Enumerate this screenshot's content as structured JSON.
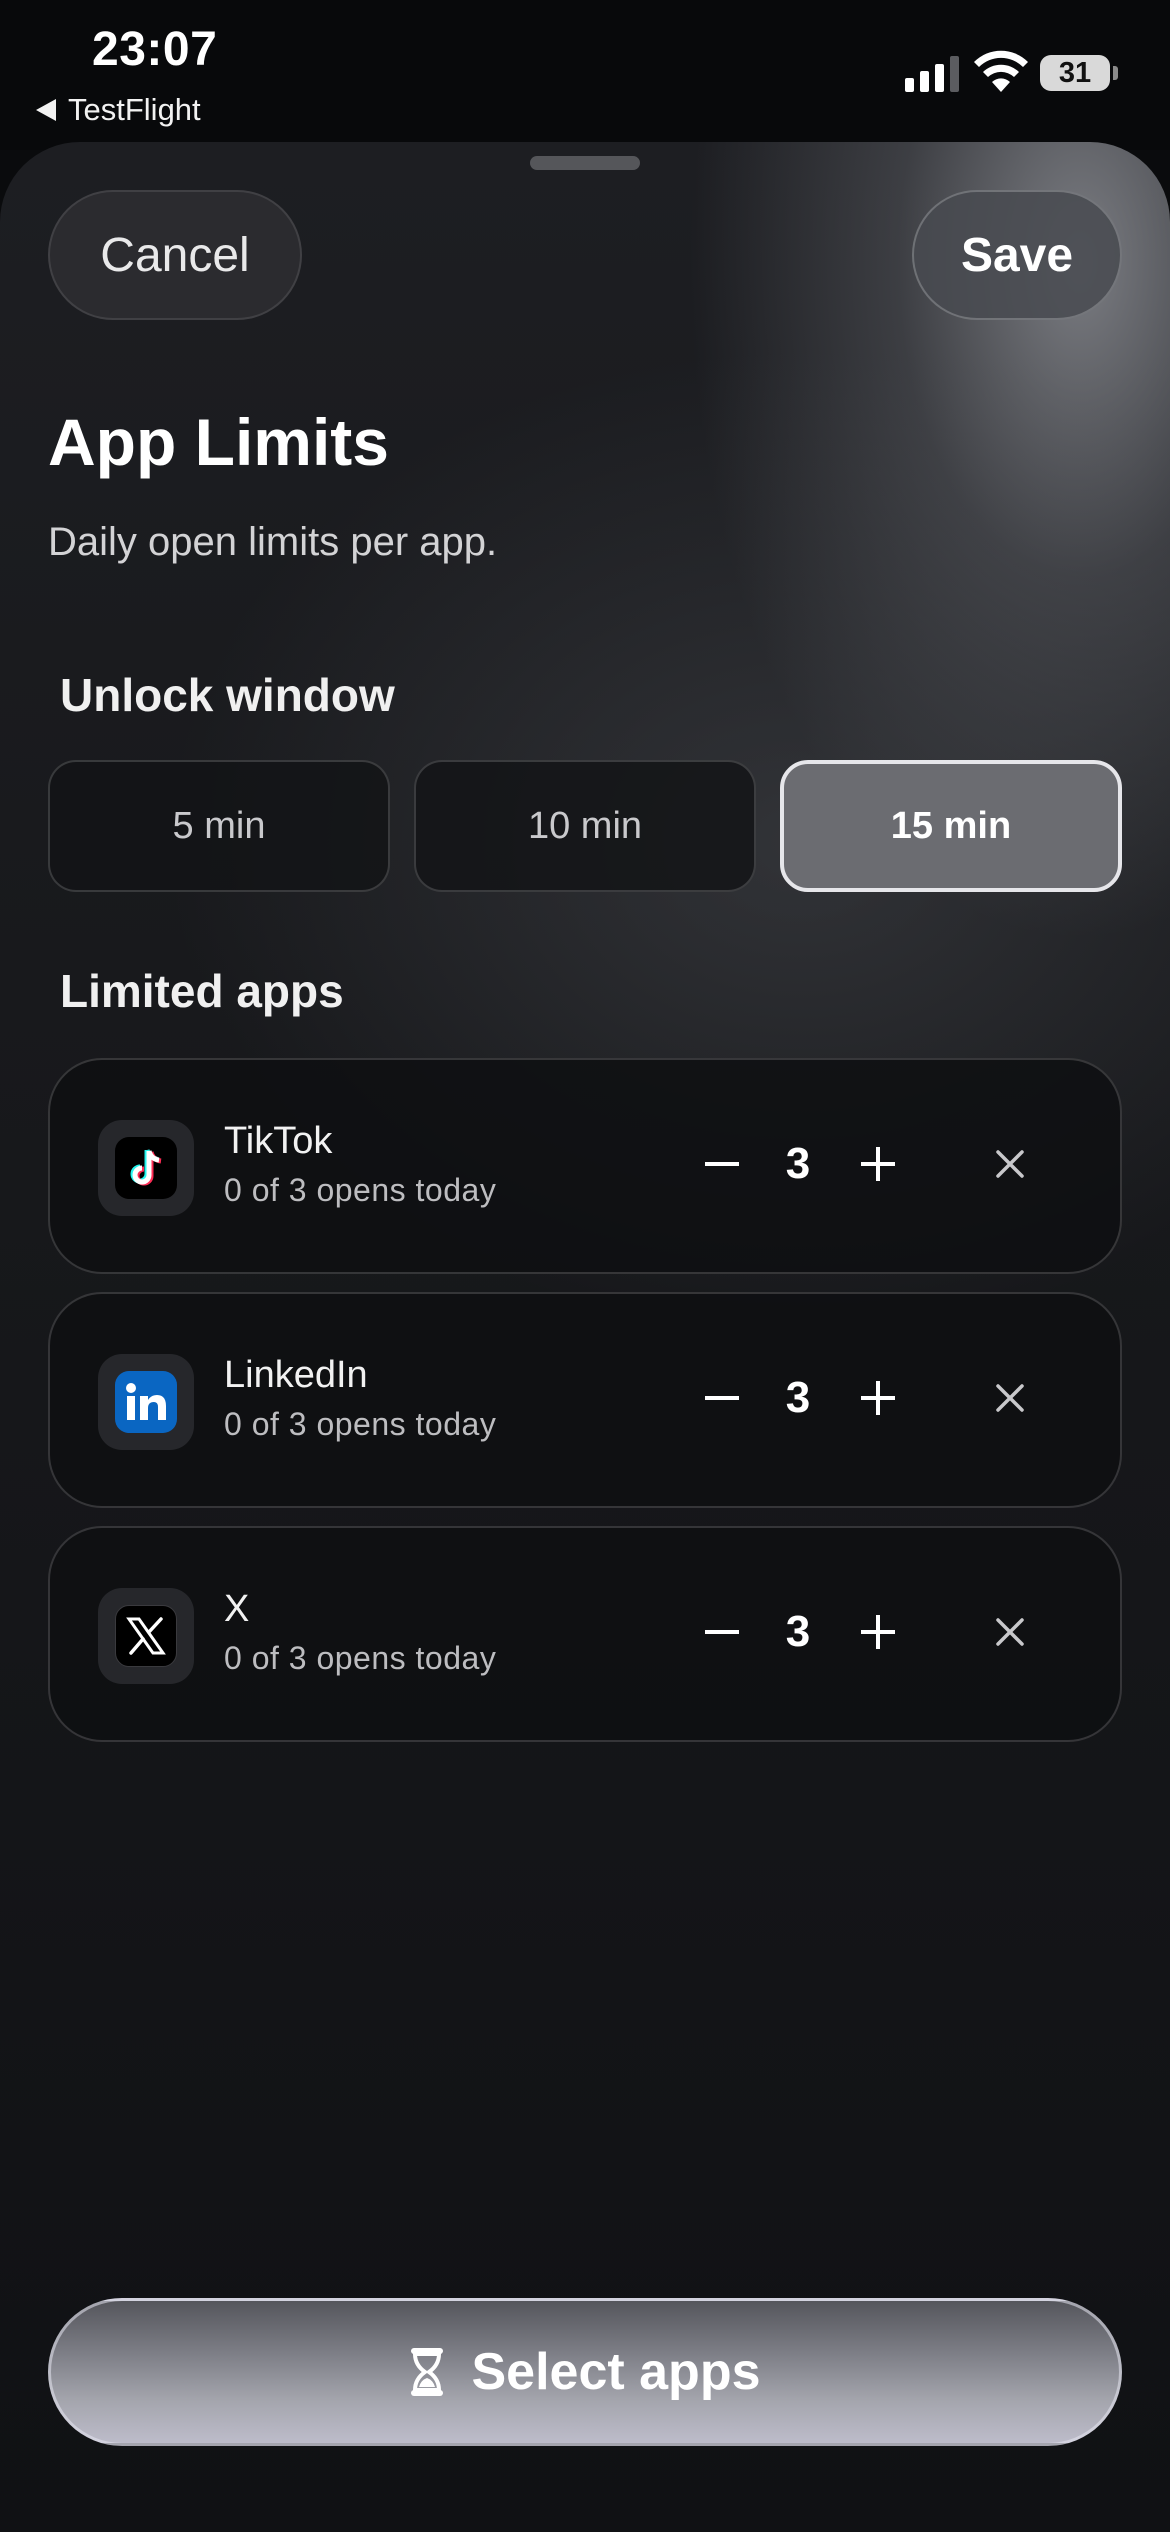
{
  "status_bar": {
    "time": "23:07",
    "back_app": "TestFlight",
    "battery_level": "31",
    "signal_bars_active": 3,
    "signal_bars_total": 4
  },
  "nav": {
    "cancel_label": "Cancel",
    "save_label": "Save"
  },
  "header": {
    "title": "App Limits",
    "subtitle": "Daily open limits per app."
  },
  "unlock_window": {
    "title": "Unlock window",
    "options": [
      "5 min",
      "10 min",
      "15 min"
    ],
    "selected": "15 min"
  },
  "limited_apps": {
    "title": "Limited apps",
    "items": [
      {
        "name": "TikTok",
        "usage": "0 of 3 opens today",
        "count": "3",
        "icon": "tiktok-icon"
      },
      {
        "name": "LinkedIn",
        "usage": "0 of 3 opens today",
        "count": "3",
        "icon": "linkedin-icon"
      },
      {
        "name": "X",
        "usage": "0 of 3 opens today",
        "count": "3",
        "icon": "x-icon"
      }
    ]
  },
  "footer": {
    "select_label": "Select apps",
    "icon": "hourglass-icon"
  },
  "colors": {
    "selected_segment": "#6b6c71",
    "linkedin_blue": "#0a66c2",
    "tiktok_cyan": "#25f4ee",
    "tiktok_red": "#fe2c55"
  }
}
